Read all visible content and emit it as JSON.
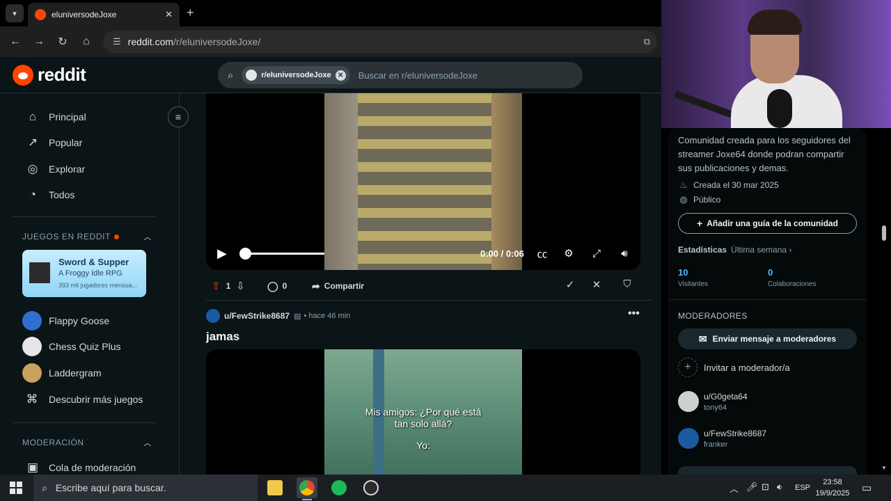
{
  "browser": {
    "tab_title": "eluniversodeJoxe",
    "tab_close": "✕",
    "new_tab": "+",
    "url_domain": "reddit.com",
    "url_path": "/r/eluniversodeJoxe/"
  },
  "reddit": {
    "logo_text": "reddit",
    "search": {
      "chip_label": "r/eluniversodeJoxe",
      "placeholder": "Buscar en r/eluniversodeJoxe"
    }
  },
  "sidebar": {
    "nav": [
      {
        "label": "Principal",
        "icon": "home-icon"
      },
      {
        "label": "Popular",
        "icon": "popular-icon"
      },
      {
        "label": "Explorar",
        "icon": "explore-icon"
      },
      {
        "label": "Todos",
        "icon": "all-icon"
      }
    ],
    "games_header": "JUEGOS EN REDDIT",
    "game_card": {
      "title": "Sword & Supper",
      "subtitle": "A Froggy Idle RPG",
      "players": "393 mil jugadores mensua..."
    },
    "games": [
      {
        "label": "Flappy Goose"
      },
      {
        "label": "Chess Quiz Plus"
      },
      {
        "label": "Laddergram"
      },
      {
        "label": "Descubrir más juegos"
      }
    ],
    "moderation_header": "MODERACIÓN",
    "mod_queue": "Cola de moderación"
  },
  "post1": {
    "time_display": "0:00 / 0:06",
    "vote_count": "1",
    "comment_count": "0",
    "share_label": "Compartir"
  },
  "post2": {
    "author": "u/FewStrike8687",
    "time": "• hace 46 min",
    "title": "jamas",
    "subtitle_line1": "Mis amigos: ¿Por qué está",
    "subtitle_line2": "tan solo allá?",
    "subtitle_line3": "Yo:"
  },
  "right_sidebar": {
    "description": "Comunidad creada para los seguidores del streamer Joxe64 donde podran compartir sus publicaciones y demas.",
    "created": "Creada el 30 mar 2025",
    "visibility": "Público",
    "guide_button": "Añadir una guía de la comunidad",
    "stats_label": "Estadísticas",
    "stats_period": "Última semana ›",
    "visitors_value": "10",
    "visitors_label": "Visitantes",
    "contrib_value": "0",
    "contrib_label": "Colaboraciones",
    "moderators_header": "MODERADORES",
    "message_mods": "Enviar mensaje a moderadores",
    "invite_mod": "Invitar a moderador/a",
    "moderators": [
      {
        "name": "u/G0geta64",
        "flair": "tony64"
      },
      {
        "name": "u/FewStrike8687",
        "flair": "franker"
      }
    ]
  },
  "taskbar": {
    "search_placeholder": "Escribe aquí para buscar.",
    "lang": "ESP",
    "time": "23:58",
    "date": "19/9/2025"
  },
  "colors": {
    "reddit_orange": "#ff4500",
    "bg": "#0b1416",
    "link_blue": "#4fbcff"
  }
}
